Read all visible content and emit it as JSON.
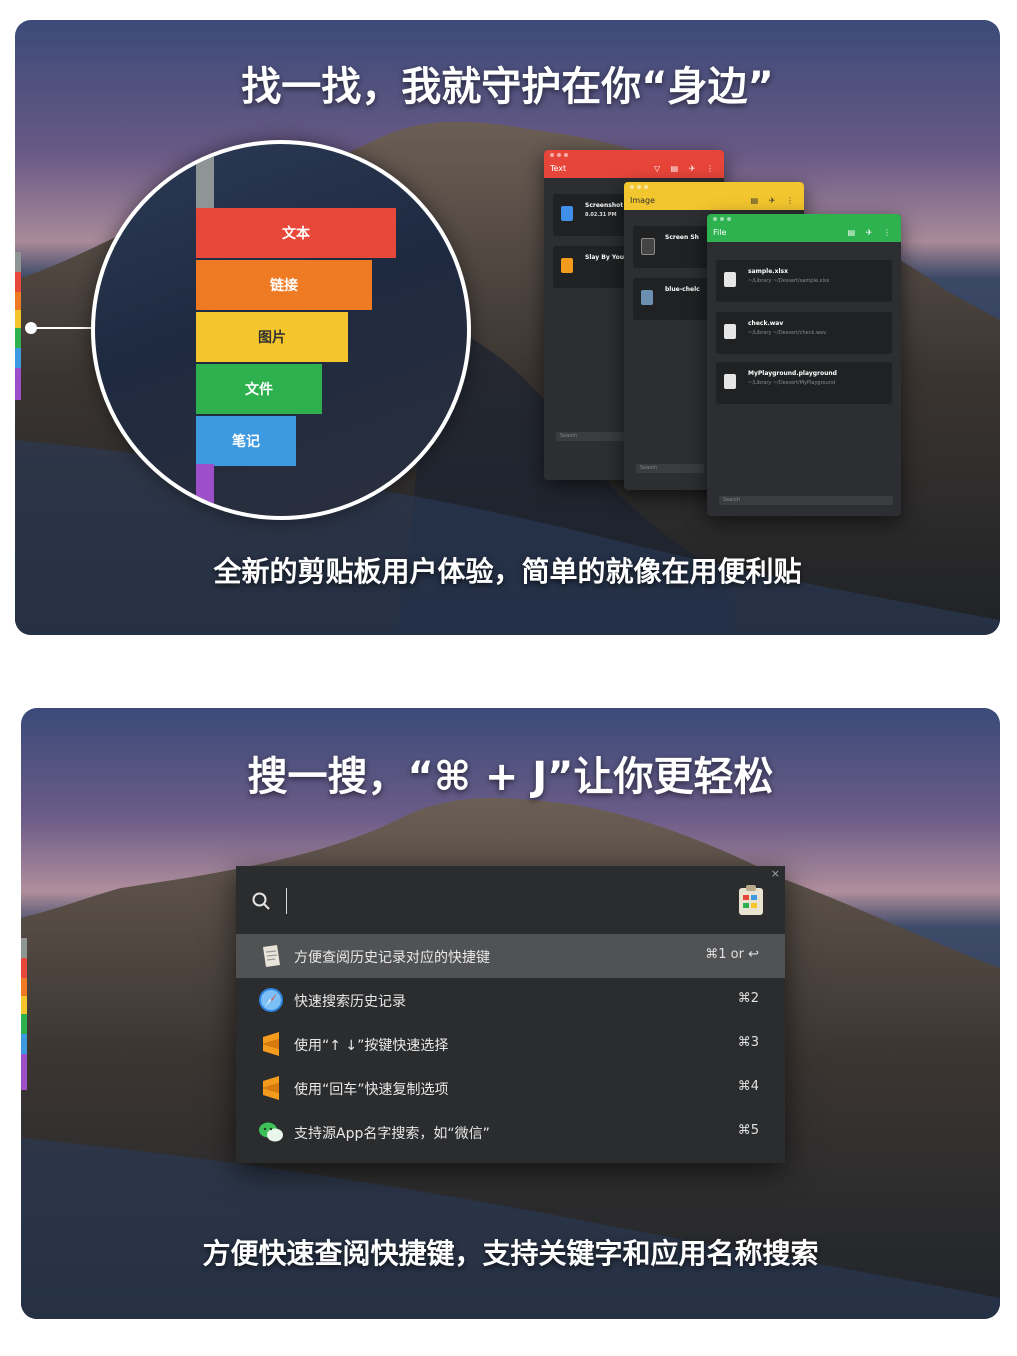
{
  "panel1": {
    "headline": "找一找，我就守护在你“身边”",
    "subline": "全新的剪贴板用户体验，简单的就像在用便利贴",
    "tabs": [
      {
        "label": "文本",
        "color": "#e8483a"
      },
      {
        "label": "链接",
        "color": "#ef7a24"
      },
      {
        "label": "图片",
        "color": "#f5c62c"
      },
      {
        "label": "文件",
        "color": "#2fb04e"
      },
      {
        "label": "笔记",
        "color": "#3e9ae0"
      }
    ],
    "windows": {
      "text": {
        "title": "Text",
        "color": "#e8453a",
        "search": "Search",
        "items": [
          {
            "name": "Screenshot",
            "meta": "8.02.31 PM"
          },
          {
            "name": "Slay By You",
            "meta": ""
          }
        ]
      },
      "image": {
        "title": "Image",
        "color": "#f2c62e",
        "search": "Search",
        "items": [
          {
            "name": "Screen Sh",
            "meta": ""
          },
          {
            "name": "blue-chelc",
            "meta": ""
          }
        ]
      },
      "file": {
        "title": "File",
        "color": "#2eb24f",
        "search": "Search",
        "items": [
          {
            "name": "sample.xlsx",
            "meta": "~/Library    ~/Dessert/sample.xlsx"
          },
          {
            "name": "check.wav",
            "meta": "~/Library    ~/Dessert/check.wav"
          },
          {
            "name": "MyPlayground.playground",
            "meta": "~/Library    ~/Dessert/MyPlayground"
          }
        ]
      }
    }
  },
  "panel2": {
    "headline": "搜一搜，“⌘ + J”让你更轻松",
    "subline": "方便快速查阅快捷键，支持关键字和应用名称搜索",
    "close_symbol": "×",
    "rows": [
      {
        "label": "方便查阅历史记录对应的快捷键",
        "shortcut": "⌘1 or",
        "return_symbol": "↩",
        "icon": "clipboard-app-icon",
        "selected": true
      },
      {
        "label": "快速搜索历史记录",
        "shortcut": "⌘2",
        "icon": "safari-icon",
        "selected": false
      },
      {
        "label": "使用“↑ ↓”按键快速选择",
        "shortcut": "⌘3",
        "icon": "sublime-text-icon",
        "selected": false
      },
      {
        "label": "使用“回车”快速复制选项",
        "shortcut": "⌘4",
        "icon": "sublime-text-icon",
        "selected": false
      },
      {
        "label": "支持源App名字搜索，如“微信”",
        "shortcut": "⌘5",
        "icon": "wechat-icon",
        "selected": false
      }
    ]
  }
}
